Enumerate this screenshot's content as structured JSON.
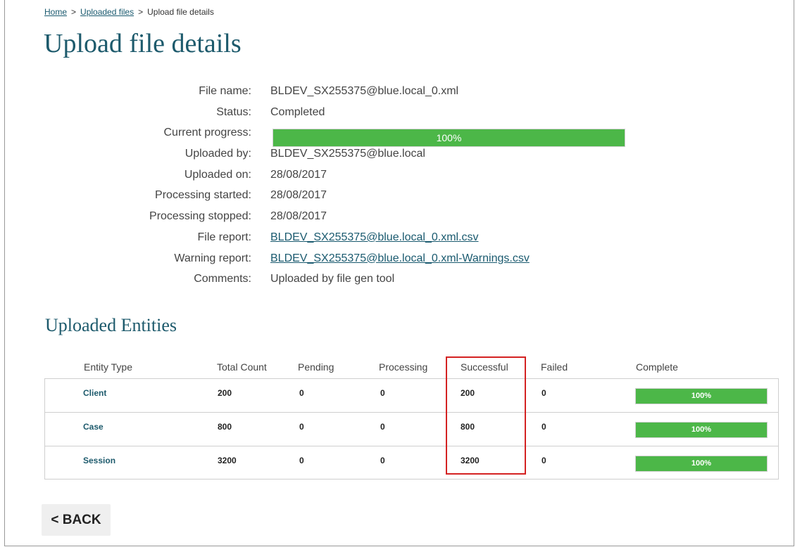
{
  "breadcrumb": {
    "home": "Home",
    "uploaded_files": "Uploaded files",
    "current": "Upload file details",
    "separator": ">"
  },
  "page_title": "Upload file details",
  "details": {
    "file_name_label": "File name:",
    "file_name": "BLDEV_SX255375@blue.local_0.xml",
    "status_label": "Status:",
    "status": "Completed",
    "progress_label": "Current progress:",
    "progress_text": "100%",
    "progress_percent": 100,
    "uploaded_by_label": "Uploaded by:",
    "uploaded_by": "BLDEV_SX255375@blue.local",
    "uploaded_on_label": "Uploaded on:",
    "uploaded_on": "28/08/2017",
    "processing_started_label": "Processing started:",
    "processing_started": "28/08/2017",
    "processing_stopped_label": "Processing stopped:",
    "processing_stopped": "28/08/2017",
    "file_report_label": "File report:",
    "file_report": "BLDEV_SX255375@blue.local_0.xml.csv",
    "warning_report_label": "Warning report:",
    "warning_report": "BLDEV_SX255375@blue.local_0.xml-Warnings.csv",
    "comments_label": "Comments:",
    "comments": "Uploaded by file gen tool"
  },
  "entities": {
    "title": "Uploaded Entities",
    "columns": [
      "Entity Type",
      "Total Count",
      "Pending",
      "Processing",
      "Successful",
      "Failed",
      "Complete"
    ],
    "rows": [
      {
        "entity": "Client",
        "total": "200",
        "pending": "0",
        "processing": "0",
        "successful": "200",
        "failed": "0",
        "complete": "100%",
        "complete_percent": 100
      },
      {
        "entity": "Case",
        "total": "800",
        "pending": "0",
        "processing": "0",
        "successful": "800",
        "failed": "0",
        "complete": "100%",
        "complete_percent": 100
      },
      {
        "entity": "Session",
        "total": "3200",
        "pending": "0",
        "processing": "0",
        "successful": "3200",
        "failed": "0",
        "complete": "100%",
        "complete_percent": 100
      }
    ]
  },
  "back_button": "< BACK",
  "colors": {
    "heading": "#1d5a6c",
    "link": "#1a5a6f",
    "progress_fill": "#4cb748",
    "highlight": "#d42222"
  }
}
